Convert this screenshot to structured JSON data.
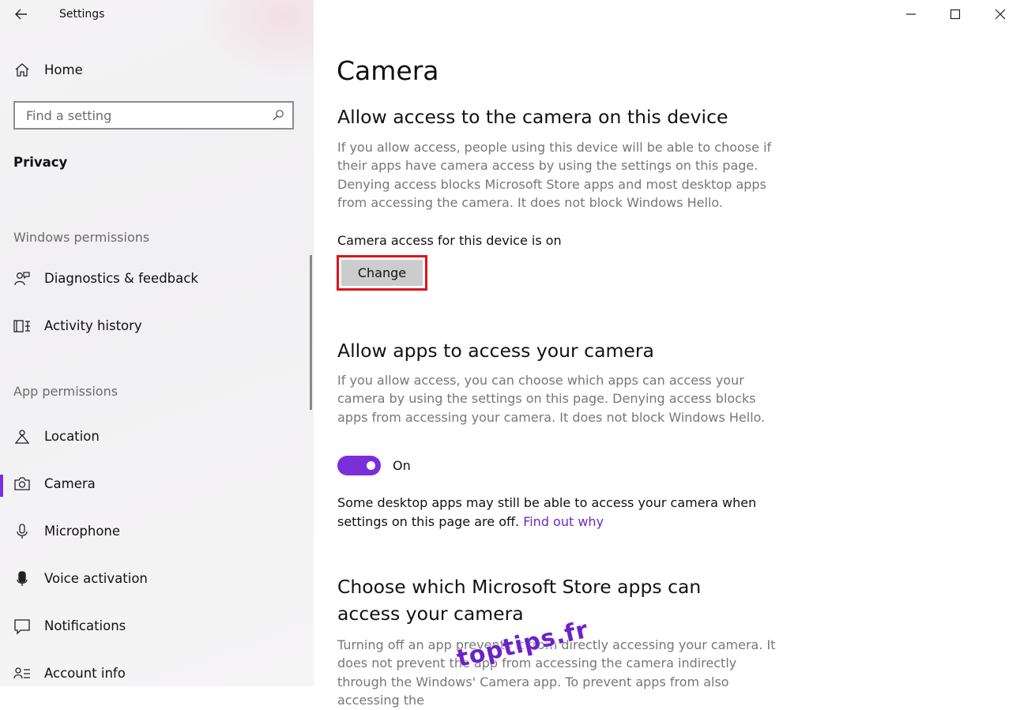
{
  "window": {
    "title": "Settings",
    "controls": [
      "minimize-icon",
      "maximize-icon",
      "close-icon"
    ]
  },
  "sidebar": {
    "home_label": "Home",
    "search_placeholder": "Find a setting",
    "current_section": "Privacy",
    "windows_permissions_label": "Windows permissions",
    "windows_items": [
      {
        "label": "Diagnostics & feedback",
        "icon": "diagnostics-icon"
      },
      {
        "label": "Activity history",
        "icon": "activity-history-icon"
      }
    ],
    "app_permissions_label": "App permissions",
    "app_items": [
      {
        "label": "Location",
        "icon": "location-icon"
      },
      {
        "label": "Camera",
        "icon": "camera-icon",
        "selected": true
      },
      {
        "label": "Microphone",
        "icon": "microphone-icon"
      },
      {
        "label": "Voice activation",
        "icon": "voice-activation-icon"
      },
      {
        "label": "Notifications",
        "icon": "notifications-icon"
      },
      {
        "label": "Account info",
        "icon": "account-info-icon"
      }
    ]
  },
  "main": {
    "title": "Camera",
    "device_section": {
      "heading": "Allow access to the camera on this device",
      "description": "If you allow access, people using this device will be able to choose if their apps have camera access by using the settings on this page. Denying access blocks Microsoft Store apps and most desktop apps from accessing the camera. It does not block Windows Hello.",
      "status": "Camera access for this device is on",
      "button_label": "Change"
    },
    "apps_section": {
      "heading": "Allow apps to access your camera",
      "description": "If you allow access, you can choose which apps can access your camera by using the settings on this page. Denying access blocks apps from accessing your camera. It does not block Windows Hello.",
      "toggle_state": "On",
      "note": "Some desktop apps may still be able to access your camera when settings on this page are off.",
      "link": "Find out why"
    },
    "store_section": {
      "heading": "Choose which Microsoft Store apps can access your camera",
      "description": "Turning off an app prevents it from directly accessing your camera. It does not prevent the app from accessing the camera indirectly through the Windows' Camera app. To prevent apps from also accessing the"
    }
  },
  "watermark": "toptips.fr",
  "colors": {
    "accent": "#7a2fdb",
    "highlight_border": "#e0131f",
    "link": "#6b2bbf",
    "sidebar_bg": "#f3f2f3"
  }
}
